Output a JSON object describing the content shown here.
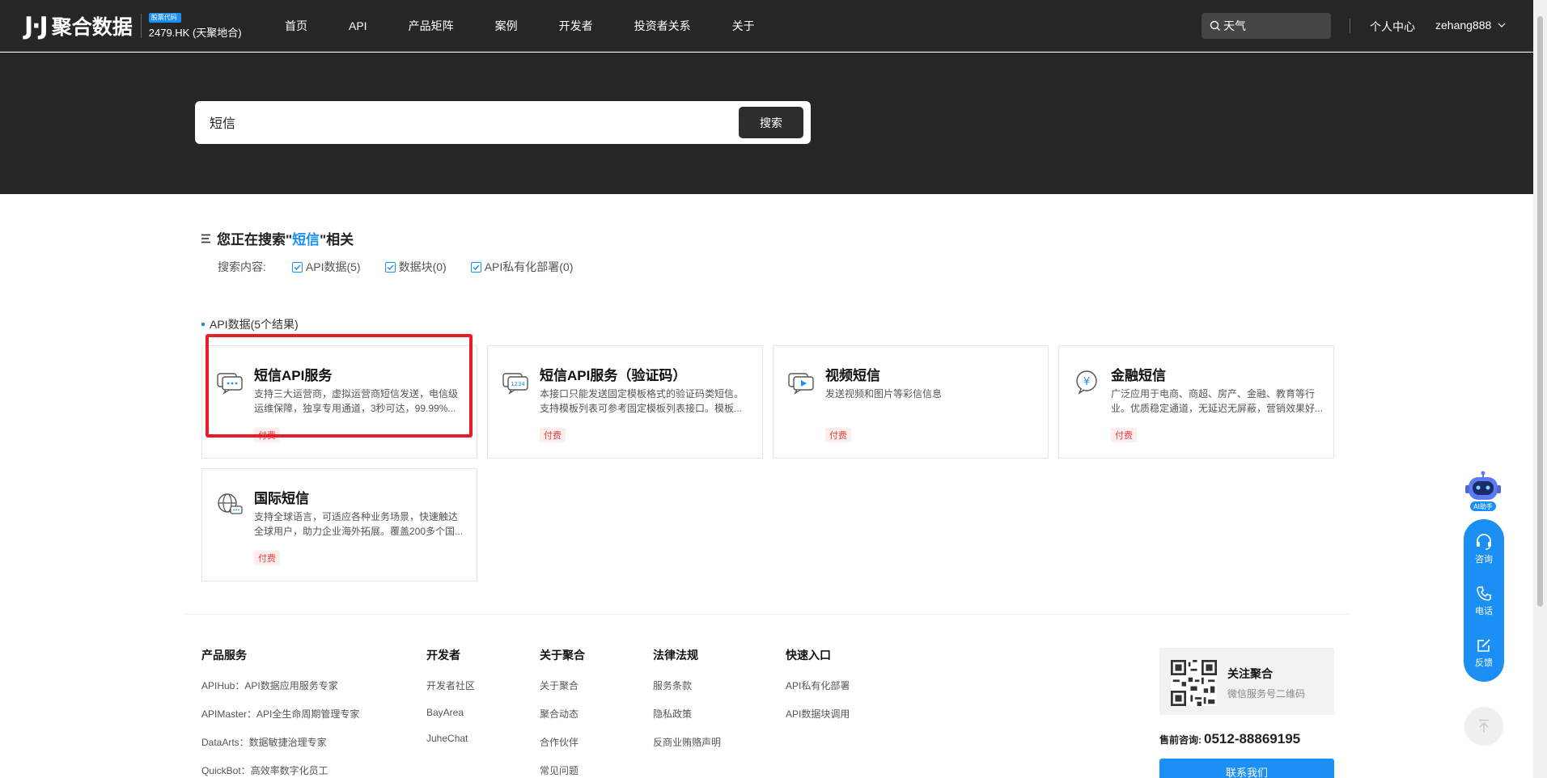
{
  "header": {
    "logo_mark": "J·J",
    "logo_text": "聚合数据",
    "stock_badge": "股票代码",
    "stock_code": "2479.HK (天聚地合)",
    "nav": [
      "首页",
      "API",
      "产品矩阵",
      "案例",
      "开发者",
      "投资者关系",
      "关于"
    ],
    "search_value": "天气",
    "personal_center": "个人中心",
    "username": "zehang888"
  },
  "hero": {
    "search_value": "短信",
    "search_button": "搜索"
  },
  "results": {
    "title_prefix": "您正在搜索\"",
    "keyword": "短信",
    "title_suffix": "\"相关",
    "filter_label": "搜索内容:",
    "filters": [
      "API数据(5)",
      "数据块(0)",
      "API私有化部署(0)"
    ],
    "section_label": "API数据(5个结果)",
    "cards": [
      {
        "title": "短信API服务",
        "desc": "支持三大运营商，虚拟运营商短信发送，电信级运维保障，独享专用通道，3秒可达，99.99%...",
        "tag": "付费",
        "icon": "chat-dots-icon"
      },
      {
        "title": "短信API服务（验证码）",
        "desc": "本接口只能发送固定模板格式的验证码类短信。支持模板列表可参考固定模板列表接口。模板...",
        "tag": "付费",
        "icon": "chat-1234-icon"
      },
      {
        "title": "视频短信",
        "desc": "发送视频和图片等彩信信息",
        "tag": "付费",
        "icon": "chat-video-icon"
      },
      {
        "title": "金融短信",
        "desc": "广泛应用于电商、商超、房产、金融、教育等行业。优质稳定通道，无延迟无屏蔽，营销效果好...",
        "tag": "付费",
        "icon": "chat-yen-icon"
      },
      {
        "title": "国际短信",
        "desc": "支持全球语言，可适应各种业务场景，快速触达全球用户，助力企业海外拓展。覆盖200多个国...",
        "tag": "付费",
        "icon": "globe-chat-icon"
      }
    ]
  },
  "footer": {
    "columns": [
      {
        "title": "产品服务",
        "links": [
          "APIHub：API数据应用服务专家",
          "APIMaster：API全生命周期管理专家",
          "DataArts：数据敏捷治理专家",
          "QuickBot：高效率数字化员工"
        ]
      },
      {
        "title": "开发者",
        "links": [
          "开发者社区",
          "BayArea",
          "JuheChat"
        ]
      },
      {
        "title": "关于聚合",
        "links": [
          "关于聚合",
          "聚合动态",
          "合作伙伴",
          "常见问题"
        ]
      },
      {
        "title": "法律法规",
        "links": [
          "服务条款",
          "隐私政策",
          "反商业贿赂声明"
        ]
      },
      {
        "title": "快速入口",
        "links": [
          "API私有化部署",
          "API数据块调用"
        ]
      }
    ],
    "qr_title": "关注聚合",
    "qr_sub": "微信服务号二维码",
    "hotline_label": "售前咨询:",
    "hotline": "0512-88869195",
    "contact_button": "联系我们"
  },
  "float": {
    "ai_label": "AI助手",
    "items": [
      "咨询",
      "电话",
      "反馈"
    ]
  },
  "colors": {
    "accent": "#1b8ff4",
    "dark": "#262626",
    "highlight": "#e81d25",
    "tag": "#e64545"
  }
}
